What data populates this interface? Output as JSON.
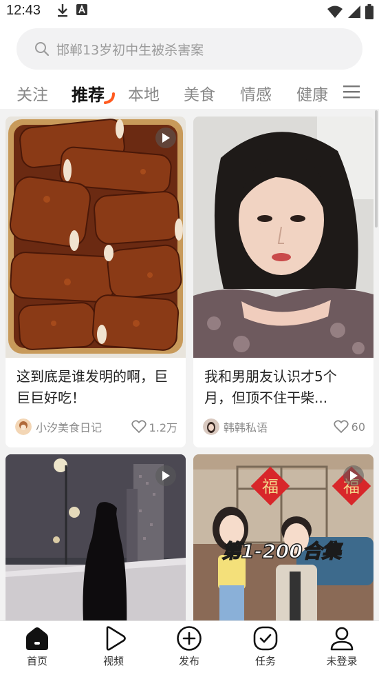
{
  "status_bar": {
    "time": "12:43",
    "left_icons": [
      "download-icon",
      "font-a-icon"
    ],
    "right_icons": [
      "wifi-icon",
      "signal-icon",
      "battery-icon"
    ]
  },
  "search": {
    "placeholder": "邯郸13岁初中生被杀害案"
  },
  "tabs": [
    {
      "label": "关注",
      "active": false
    },
    {
      "label": "推荐",
      "active": true
    },
    {
      "label": "本地",
      "active": false
    },
    {
      "label": "美食",
      "active": false
    },
    {
      "label": "情感",
      "active": false
    },
    {
      "label": "健康",
      "active": false
    }
  ],
  "colors": {
    "accent": "#ff5a1f",
    "background": "#f2f2f2",
    "muted_text": "#8a8a8a"
  },
  "feed": {
    "cards": [
      {
        "title": "这到底是谁发明的啊，巨巨巨好吃！",
        "author": "小汐美食日记",
        "likes": "1.2万",
        "is_video": true
      },
      {
        "title": "我和男朋友认识才5个月，但顶不住干柴...",
        "author": "韩韩私语",
        "likes": "60",
        "is_video": false
      },
      {
        "title": "",
        "author": "",
        "likes": "",
        "is_video": true
      },
      {
        "title": "",
        "overlay_text": "第1-200合集",
        "banner_left": "福",
        "banner_right": "福",
        "author": "",
        "likes": "",
        "is_video": true
      }
    ]
  },
  "bottom_nav": [
    {
      "label": "首页",
      "icon": "home-icon",
      "active": true
    },
    {
      "label": "视频",
      "icon": "play-icon",
      "active": false
    },
    {
      "label": "发布",
      "icon": "plus-circle-icon",
      "active": false
    },
    {
      "label": "任务",
      "icon": "check-circle-icon",
      "active": false
    },
    {
      "label": "未登录",
      "icon": "user-icon",
      "active": false
    }
  ]
}
